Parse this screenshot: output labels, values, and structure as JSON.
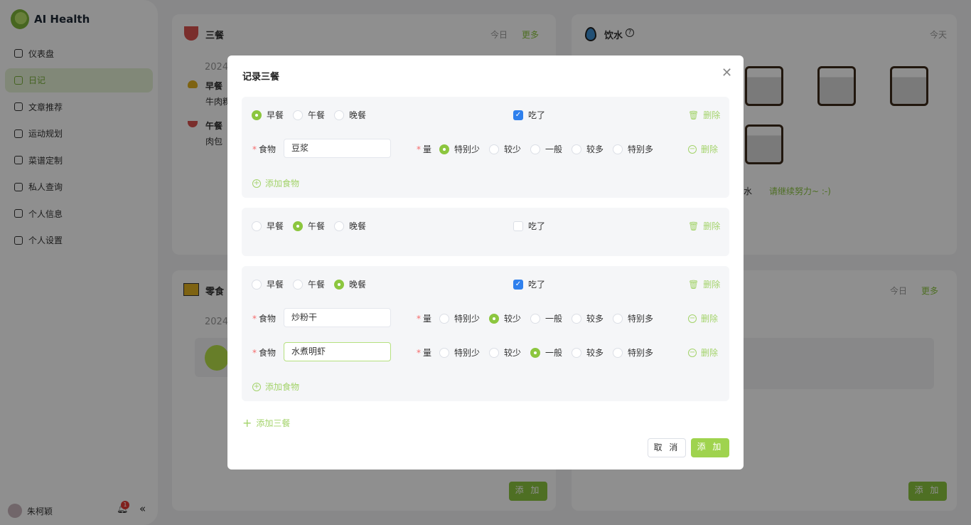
{
  "app": {
    "brand": "AI Health"
  },
  "sidebar": {
    "items": [
      {
        "label": "仪表盘",
        "icon": "pie-chart-icon"
      },
      {
        "label": "日记",
        "icon": "grid-icon",
        "active": true
      },
      {
        "label": "文章推荐",
        "icon": "book-icon"
      },
      {
        "label": "运动规划",
        "icon": "tag-icon"
      },
      {
        "label": "菜谱定制",
        "icon": "alarm-icon"
      },
      {
        "label": "私人查询",
        "icon": "id-card-icon"
      },
      {
        "label": "个人信息",
        "icon": "user-icon"
      },
      {
        "label": "个人设置",
        "icon": "gear-icon"
      }
    ],
    "user": "朱柯颖",
    "notifications": "1"
  },
  "meals_card": {
    "title": "三餐",
    "today": "今日",
    "more": "更多",
    "date": "2024-",
    "entries": [
      {
        "meal": "早餐",
        "food": "牛肉粿"
      },
      {
        "meal": "午餐",
        "food": "肉包"
      }
    ]
  },
  "water_card": {
    "title": "饮水",
    "today": "今天",
    "cups_shown": 7,
    "footer": "杯水",
    "encourage": "请继续努力~ :-)"
  },
  "snack_card": {
    "title": "零食",
    "date": "2024-",
    "add": "添 加"
  },
  "right_card": {
    "today": "今日",
    "more": "更多",
    "add": "添 加"
  },
  "modal": {
    "title": "记录三餐",
    "meal_options": [
      "早餐",
      "午餐",
      "晚餐"
    ],
    "eaten_label": "吃了",
    "delete_label": "删除",
    "food_label": "食物",
    "amount_label": "量",
    "amount_options": [
      "特别少",
      "较少",
      "一般",
      "较多",
      "特别多"
    ],
    "add_food": "添加食物",
    "add_meal": "添加三餐",
    "cancel": "取 消",
    "submit": "添 加",
    "groups": [
      {
        "meal": 0,
        "eaten": true,
        "foods": [
          {
            "name": "豆浆",
            "amount": 0
          }
        ]
      },
      {
        "meal": 1,
        "eaten": false,
        "foods": []
      },
      {
        "meal": 2,
        "eaten": true,
        "foods": [
          {
            "name": "炒粉干",
            "amount": 1
          },
          {
            "name": "水煮明虾",
            "amount": 2,
            "focused": true
          }
        ]
      }
    ]
  },
  "colors": {
    "accent": "#8cc63f",
    "checkbox": "#2f80ed",
    "required": "#f56c6c"
  }
}
